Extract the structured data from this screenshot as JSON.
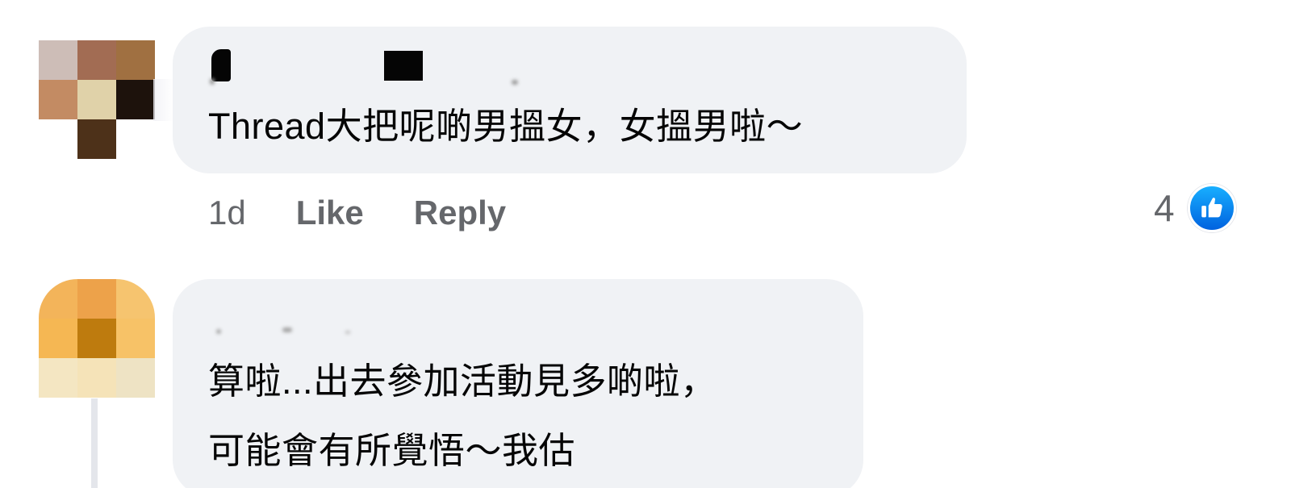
{
  "comments": [
    {
      "author": "",
      "text": "Thread大把呢啲男搵女，女搵男啦～",
      "actions": {
        "time": "1d",
        "like_label": "Like",
        "reply_label": "Reply"
      },
      "reactions": {
        "count": "4",
        "icon": "like-thumbs-up-icon",
        "color": "#1877f2"
      }
    },
    {
      "author": "",
      "text_lines": [
        "算啦...出去參加活動見多啲啦，",
        "可能會有所覺悟～我估"
      ]
    }
  ]
}
